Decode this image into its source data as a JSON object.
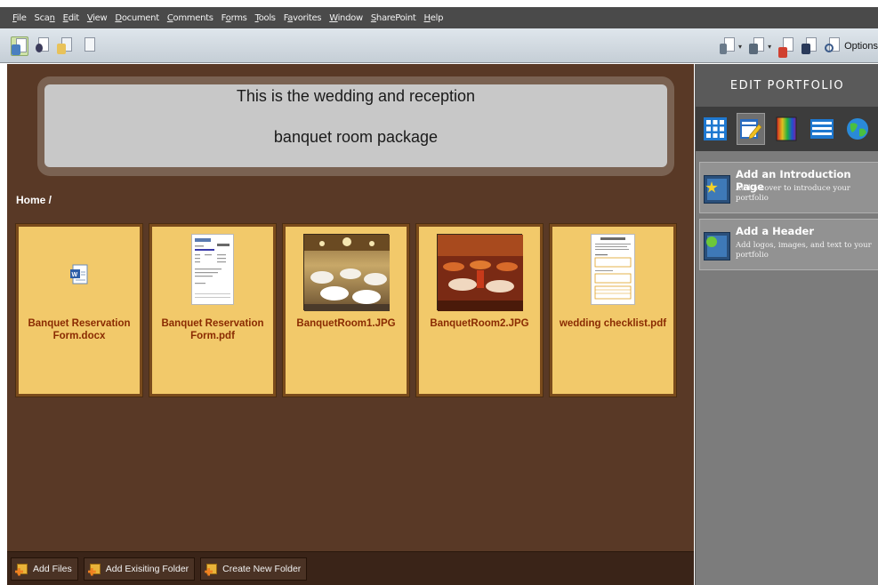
{
  "menu": {
    "items": [
      "File",
      "Scan",
      "Edit",
      "View",
      "Document",
      "Comments",
      "Forms",
      "Tools",
      "Favorites",
      "Window",
      "SharePoint",
      "Help"
    ],
    "underlined_letters": [
      "F",
      "n",
      "E",
      "V",
      "D",
      "C",
      "o",
      "T",
      "a",
      "W",
      "S",
      "H"
    ]
  },
  "toolbar": {
    "left_icons": [
      "portfolio-layout-icon",
      "portfolio-people-icon",
      "portfolio-pages-icon",
      "portfolio-blank-icon"
    ],
    "right_icons": [
      "combine-files-icon",
      "print-icon",
      "email-pdf-icon",
      "search-binoculars-icon",
      "options-view-icon"
    ],
    "options_label": "Options"
  },
  "banner": {
    "text_line1": "This is the wedding and reception",
    "text_line2": "banquet room package"
  },
  "breadcrumb": "Home /",
  "files": [
    {
      "name": "Banquet Reservation Form.docx",
      "line1": "Banquet Reservation",
      "line2": "Form.docx",
      "thumb": "word-document-icon"
    },
    {
      "name": "Banquet Reservation Form.pdf",
      "line1": "Banquet Reservation",
      "line2": "Form.pdf",
      "thumb": "pdf-form-preview"
    },
    {
      "name": "BanquetRoom1.JPG",
      "line1": "BanquetRoom1.JPG",
      "line2": "",
      "thumb": "banquet-room-photo-1"
    },
    {
      "name": "BanquetRoom2.JPG",
      "line1": "BanquetRoom2.JPG",
      "line2": "",
      "thumb": "banquet-room-photo-2"
    },
    {
      "name": "wedding checklist.pdf",
      "line1": "wedding checklist.pdf",
      "line2": "",
      "thumb": "checklist-pdf-preview"
    }
  ],
  "bottom_bar": {
    "add_files": "Add Files",
    "add_existing_folder": "Add Exisiting Folder",
    "create_new_folder": "Create New Folder"
  },
  "right_panel": {
    "title": "EDIT PORTFOLIO",
    "tabs": [
      "layouts-tab-icon",
      "edit-tab-icon",
      "color-schemes-tab-icon",
      "file-details-tab-icon",
      "publish-tab-icon"
    ],
    "items": [
      {
        "title": "Add an Introduction Page",
        "desc": "Add a cover to introduce your portfolio"
      },
      {
        "title": "Add a Header",
        "desc": "Add logos, images, and text to your portfolio"
      }
    ]
  },
  "colors": {
    "main_bg": "#593926",
    "card_bg": "#f2c96a",
    "card_text": "#8a2b02",
    "panel_bg": "#7c7c7c",
    "menubar_bg": "#4a4a4a"
  }
}
